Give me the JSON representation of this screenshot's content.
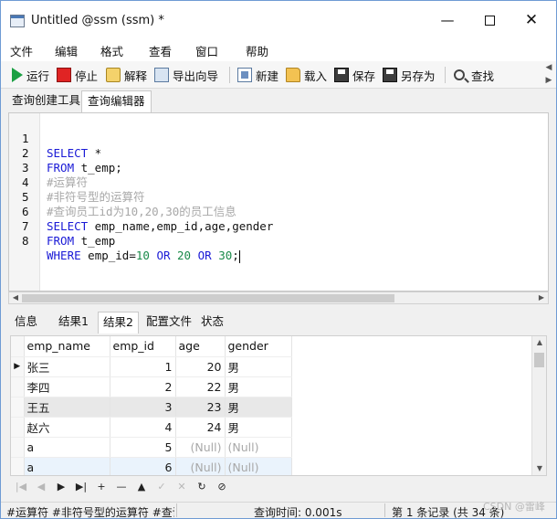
{
  "window": {
    "title": "Untitled @ssm (ssm) *",
    "minimize": "—",
    "close": "✕"
  },
  "menu": [
    "文件",
    "编辑",
    "格式",
    "查看",
    "窗口",
    "帮助"
  ],
  "toolbar": {
    "run": "运行",
    "stop": "停止",
    "explain": "解释",
    "export_wizard": "导出向导",
    "new": "新建",
    "load": "载入",
    "save": "保存",
    "save_as": "另存为",
    "find": "查找"
  },
  "query_tabs": [
    "查询创建工具",
    "查询编辑器"
  ],
  "editor": {
    "line_numbers": [
      "1",
      "2",
      "3",
      "4",
      "5",
      "6",
      "7",
      "8"
    ],
    "lines": [
      {
        "kw": "SELECT",
        "rest": " *"
      },
      {
        "kw": "FROM",
        "rest": " t_emp;"
      },
      {
        "comment": "#运算符"
      },
      {
        "comment": "#非符号型的运算符"
      },
      {
        "comment": "#查询员工id为10,20,30的员工信息"
      },
      {
        "kw": "SELECT",
        "rest": " emp_name,emp_id,age,gender"
      },
      {
        "kw": "FROM",
        "rest": " t_emp"
      },
      {
        "kw": "WHERE",
        "p1": " emp_id=",
        "n1": "10",
        "kw2": " OR ",
        "n2": "20",
        "kw3": " OR ",
        "n3": "30",
        "end": ";"
      }
    ]
  },
  "result_tabs": [
    "信息",
    "结果1",
    "结果2",
    "配置文件",
    "状态"
  ],
  "grid": {
    "columns": [
      "emp_name",
      "emp_id",
      "age",
      "gender"
    ],
    "rows": [
      [
        "张三",
        "1",
        "20",
        "男"
      ],
      [
        "李四",
        "2",
        "22",
        "男"
      ],
      [
        "王五",
        "3",
        "23",
        "男"
      ],
      [
        "赵六",
        "4",
        "24",
        "男"
      ],
      [
        "a",
        "5",
        "(Null)",
        "(Null)"
      ],
      [
        "a",
        "6",
        "(Null)",
        "(Null)"
      ]
    ]
  },
  "navigation": [
    "|◀",
    "◀",
    "▶",
    "▶|",
    "+",
    "—",
    "▲",
    "✓",
    "✕",
    "↻",
    "⊘"
  ],
  "status": {
    "sql": "#运算符 #非符号型的运算符 #查询",
    "query_time": "查询时间: 0.001s",
    "records": "第 1 条记录 (共 34 条)"
  },
  "watermark": "CSDN @雷峰"
}
